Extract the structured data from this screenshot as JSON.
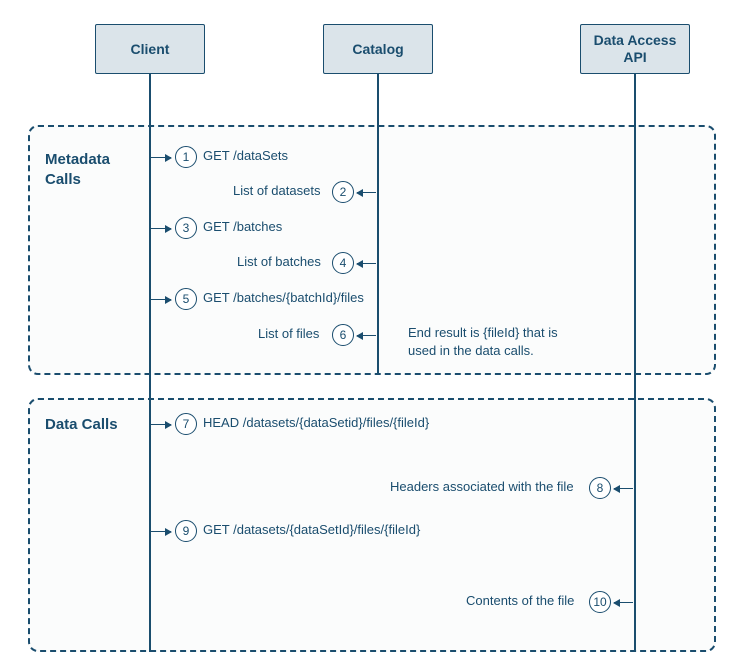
{
  "actors": {
    "client": "Client",
    "catalog": "Catalog",
    "data_access": "Data Access API"
  },
  "sections": {
    "metadata": "Metadata Calls",
    "data": "Data Calls"
  },
  "steps": {
    "s1": {
      "n": "1",
      "label": "GET /dataSets"
    },
    "s2": {
      "n": "2",
      "label": "List of datasets"
    },
    "s3": {
      "n": "3",
      "label": "GET /batches"
    },
    "s4": {
      "n": "4",
      "label": "List of batches"
    },
    "s5": {
      "n": "5",
      "label": "GET /batches/{batchId}/files"
    },
    "s6": {
      "n": "6",
      "label": "List of files"
    },
    "s7": {
      "n": "7",
      "label": "HEAD /datasets/{dataSetid}/files/{fileId}"
    },
    "s8": {
      "n": "8",
      "label": "Headers associated with the file"
    },
    "s9": {
      "n": "9",
      "label": "GET /datasets/{dataSetId}/files/{fileId}"
    },
    "s10": {
      "n": "10",
      "label": "Contents of the file"
    }
  },
  "note_end_result": "End result is {fileId} that is used in the data calls."
}
